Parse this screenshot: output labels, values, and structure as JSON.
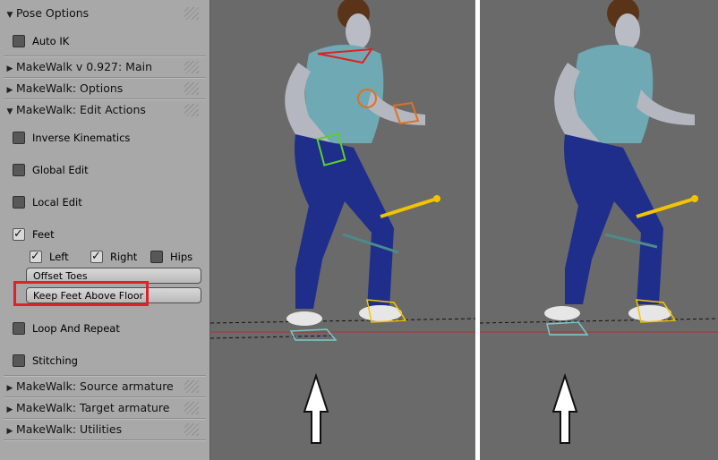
{
  "pose_options": {
    "title": "Pose Options",
    "auto_ik": "Auto IK"
  },
  "main_header": "MakeWalk v 0.927: Main",
  "options_header": "MakeWalk: Options",
  "edit_actions": {
    "title": "MakeWalk: Edit Actions",
    "inverse_kinematics": "Inverse Kinematics",
    "global_edit": "Global Edit",
    "local_edit": "Local Edit",
    "feet": "Feet",
    "left": "Left",
    "right": "Right",
    "hips": "Hips",
    "offset_toes": "Offset Toes",
    "keep_feet_above_floor": "Keep Feet Above Floor",
    "loop_and_repeat": "Loop And Repeat",
    "stitching": "Stitching"
  },
  "source_header": "MakeWalk: Source armature",
  "target_header": "MakeWalk: Target armature",
  "utilities_header": "MakeWalk: Utilities",
  "checkbox_states": {
    "auto_ik": false,
    "inverse_kinematics": false,
    "global_edit": false,
    "local_edit": false,
    "feet": true,
    "left": true,
    "right": true,
    "hips": false,
    "loop_and_repeat": false,
    "stitching": false
  },
  "colors": {
    "highlight": "#e0202a",
    "viewport_bg": "#6a6a6a",
    "panel_bg": "#a8a8a8",
    "pants": "#1f2e8a",
    "shirt": "#6fa9b4",
    "ik_bone": "#f2c400"
  }
}
